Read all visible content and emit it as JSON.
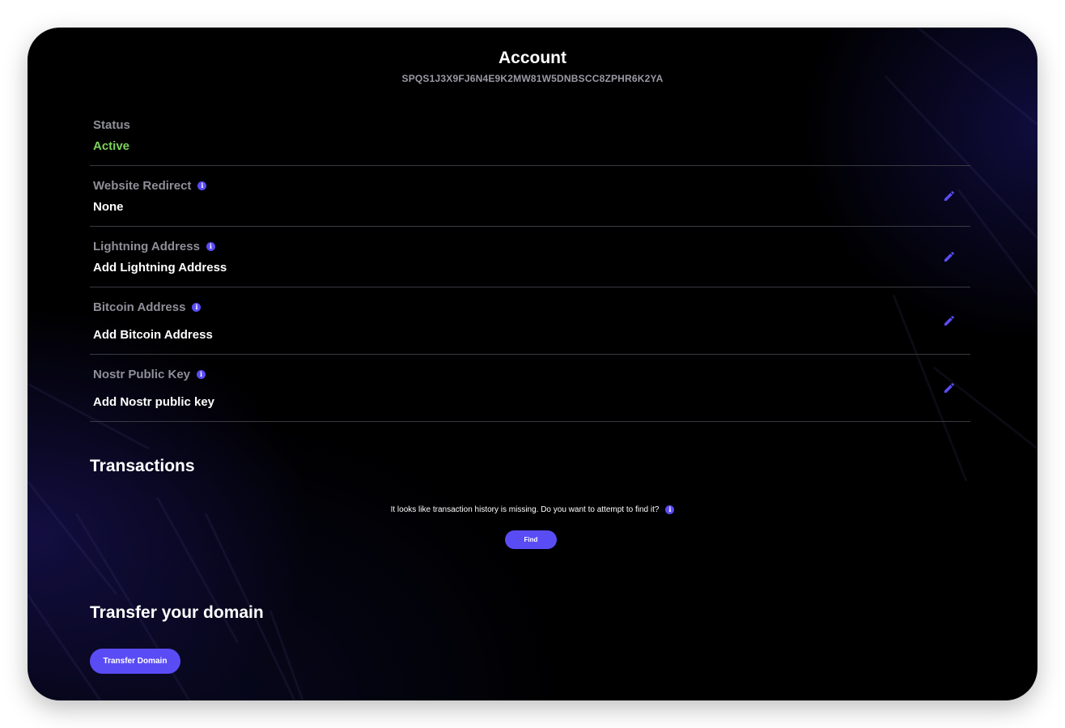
{
  "header": {
    "title": "Account",
    "account_id": "SPQS1J3X9FJ6N4E9K2MW81W5DNBSCC8ZPHR6K2YA"
  },
  "rows": [
    {
      "label": "Status",
      "value": "Active",
      "has_info": false,
      "editable": false
    },
    {
      "label": "Website Redirect",
      "value": "None",
      "has_info": true,
      "editable": true
    },
    {
      "label": "Lightning Address",
      "value": "Add Lightning Address",
      "has_info": true,
      "editable": true
    },
    {
      "label": "Bitcoin Address",
      "value": "Add Bitcoin Address",
      "has_info": true,
      "editable": true
    },
    {
      "label": "Nostr Public Key",
      "value": "Add Nostr public key",
      "has_info": true,
      "editable": true
    }
  ],
  "transactions": {
    "title": "Transactions",
    "missing_message": "It looks like transaction history is missing. Do you want to attempt to find it?",
    "find_label": "Find"
  },
  "transfer": {
    "title": "Transfer your domain",
    "button_label": "Transfer Domain"
  },
  "colors": {
    "accent": "#5a4cf5",
    "status_active": "#7dd35a",
    "label_gray": "#8f8f99",
    "divider": "#3a3a42",
    "background": "#000000"
  },
  "icons": {
    "info": "info-icon",
    "edit": "pencil-icon"
  }
}
